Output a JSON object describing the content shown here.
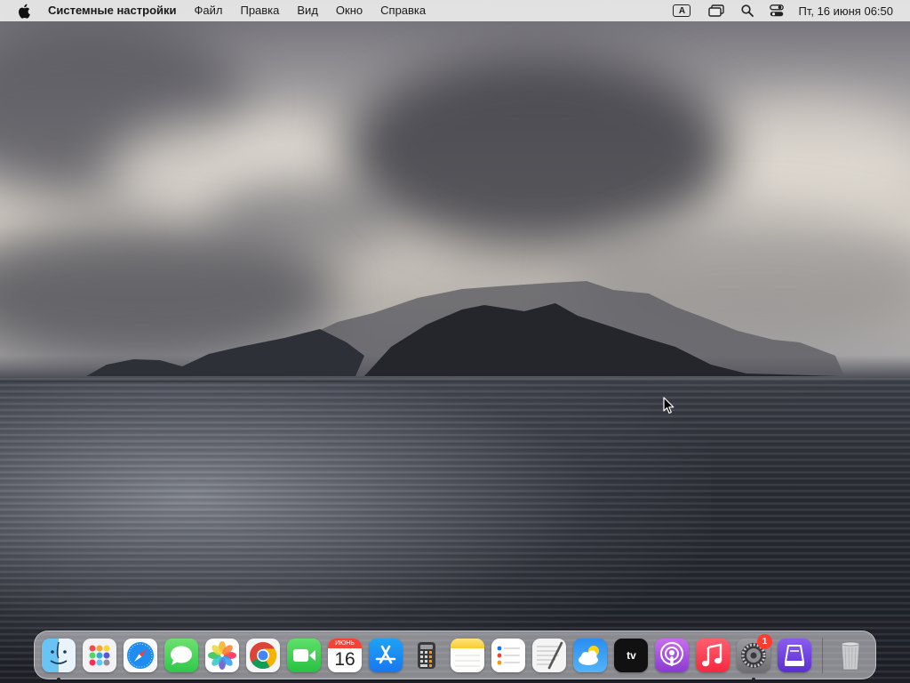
{
  "menubar": {
    "app_name": "Системные настройки",
    "menus": [
      "Файл",
      "Правка",
      "Вид",
      "Окно",
      "Справка"
    ],
    "input_source": "A",
    "clock": "Пт, 16 июня  06:50"
  },
  "dock": {
    "apps": [
      {
        "name": "Finder",
        "icon": "finder-icon",
        "running": true
      },
      {
        "name": "Launchpad",
        "icon": "launchpad-icon"
      },
      {
        "name": "Safari",
        "icon": "safari-icon"
      },
      {
        "name": "Сообщения",
        "icon": "messages-icon"
      },
      {
        "name": "Фото",
        "icon": "photos-icon"
      },
      {
        "name": "Google Chrome",
        "icon": "chrome-icon"
      },
      {
        "name": "FaceTime",
        "icon": "facetime-icon"
      },
      {
        "name": "Календарь",
        "icon": "calendar-icon"
      },
      {
        "name": "App Store",
        "icon": "app-store-icon"
      },
      {
        "name": "Калькулятор",
        "icon": "calculator-icon"
      },
      {
        "name": "Заметки",
        "icon": "notes-icon"
      },
      {
        "name": "Напоминания",
        "icon": "reminders-icon"
      },
      {
        "name": "TextEdit",
        "icon": "textedit-icon"
      },
      {
        "name": "Погода",
        "icon": "weather-icon"
      },
      {
        "name": "TV",
        "icon": "apple-tv-icon"
      },
      {
        "name": "Подкасты",
        "icon": "podcasts-icon"
      },
      {
        "name": "Музыка",
        "icon": "music-icon"
      },
      {
        "name": "Системные настройки",
        "icon": "system-settings-icon",
        "running": true
      },
      {
        "name": "Утилита",
        "icon": "utility-icon"
      },
      {
        "name": "Корзина",
        "icon": "trash-icon"
      }
    ],
    "calendar_month": "ИЮНЬ",
    "calendar_day": "16",
    "tv_label": "tv",
    "settings_badge": "1"
  },
  "colors": {
    "badge": "#ff3b30",
    "menubar_bg": "#ececec"
  }
}
